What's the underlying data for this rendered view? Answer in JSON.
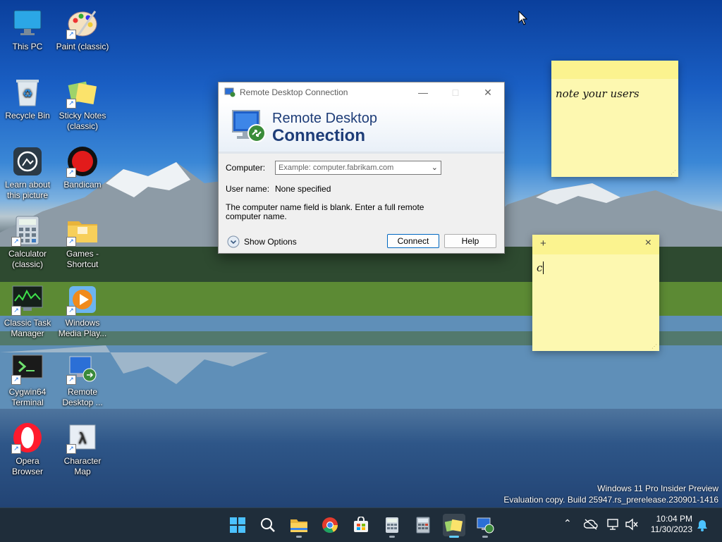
{
  "desktop": {
    "icons": [
      {
        "label": "This PC",
        "icon": "monitor-icon"
      },
      {
        "label": "Paint (classic)",
        "icon": "paint-palette-icon"
      },
      {
        "label": "Recycle Bin",
        "icon": "recycle-bin-icon"
      },
      {
        "label": "Sticky Notes (classic)",
        "icon": "sticky-notes-icon"
      },
      {
        "label": "Learn about this picture",
        "icon": "camera-icon"
      },
      {
        "label": "Bandicam",
        "icon": "record-icon"
      },
      {
        "label": "Calculator (classic)",
        "icon": "calculator-icon"
      },
      {
        "label": "Games - Shortcut",
        "icon": "folder-icon"
      },
      {
        "label": "Classic Task Manager",
        "icon": "task-manager-icon"
      },
      {
        "label": "Windows Media Play...",
        "icon": "media-player-icon"
      },
      {
        "label": "Cygwin64 Terminal",
        "icon": "terminal-icon"
      },
      {
        "label": "Remote Desktop ...",
        "icon": "remote-desktop-icon"
      },
      {
        "label": "Opera Browser",
        "icon": "opera-icon"
      },
      {
        "label": "Character Map",
        "icon": "character-map-icon"
      }
    ]
  },
  "rdp_window": {
    "title": "Remote Desktop Connection",
    "banner_line1": "Remote Desktop",
    "banner_line2": "Connection",
    "computer_label": "Computer:",
    "computer_placeholder": "Example: computer.fabrikam.com",
    "username_label": "User name:",
    "username_value": "None specified",
    "message": "The computer name field is blank. Enter a full remote computer name.",
    "show_options": "Show Options",
    "connect_button": "Connect",
    "help_button": "Help"
  },
  "sticky_notes": [
    {
      "text": "note your users"
    },
    {
      "add_symbol": "+",
      "close_symbol": "×",
      "text": "c"
    }
  ],
  "watermark": {
    "line1": "Windows 11 Pro Insider Preview",
    "line2": "Evaluation copy. Build 25947.rs_prerelease.230901-1416"
  },
  "taskbar": {
    "apps": [
      "start",
      "search",
      "file-explorer",
      "chrome",
      "microsoft-store",
      "calculator",
      "calculator-classic",
      "sticky-notes",
      "remote-desktop"
    ],
    "time": "10:04 PM",
    "date": "11/30/2023"
  }
}
